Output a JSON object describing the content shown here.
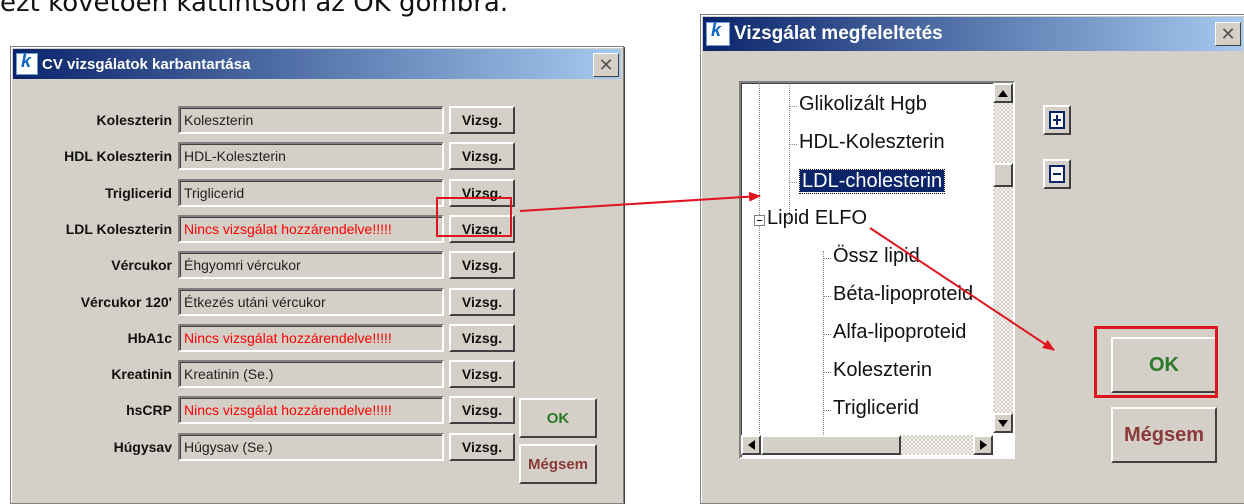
{
  "intro_text": "ezt követően kattintson az OK gombra.",
  "colors": {
    "title_start": "#0a246a",
    "highlight": "#e0141e",
    "missing_text": "#ff0000",
    "ok_text": "#2a7a2a",
    "cancel_text": "#8a3a3a"
  },
  "cv_window": {
    "title": "CV vizsgálatok karbantartása",
    "close_symbol": "✕",
    "rows": [
      {
        "label": "Koleszterin",
        "value": "Koleszterin",
        "missing": false,
        "button": "Vizsg."
      },
      {
        "label": "HDL Koleszterin",
        "value": "HDL-Koleszterin",
        "missing": false,
        "button": "Vizsg."
      },
      {
        "label": "Triglicerid",
        "value": "Triglicerid",
        "missing": false,
        "button": "Vizsg."
      },
      {
        "label": "LDL Koleszterin",
        "value": "Nincs vizsgálat hozzárendelve!!!!!",
        "missing": true,
        "button": "Vizsg."
      },
      {
        "label": "Vércukor",
        "value": "Éhgyomri vércukor",
        "missing": false,
        "button": "Vizsg."
      },
      {
        "label": "Vércukor 120'",
        "value": "Étkezés utáni vércukor",
        "missing": false,
        "button": "Vizsg."
      },
      {
        "label": "HbA1c",
        "value": "Nincs vizsgálat hozzárendelve!!!!!",
        "missing": true,
        "button": "Vizsg."
      },
      {
        "label": "Kreatinin",
        "value": "Kreatinin (Se.)",
        "missing": false,
        "button": "Vizsg."
      },
      {
        "label": "hsCRP",
        "value": "Nincs vizsgálat hozzárendelve!!!!!",
        "missing": true,
        "button": "Vizsg."
      },
      {
        "label": "Húgysav",
        "value": "Húgysav (Se.)",
        "missing": false,
        "button": "Vizsg."
      }
    ],
    "ok_label": "OK",
    "cancel_label": "Mégsem"
  },
  "match_window": {
    "title": "Vizsgálat megfeleltetés",
    "close_symbol": "✕",
    "tree_items": [
      {
        "label": "Glikolizált Hgb"
      },
      {
        "label": "HDL-Koleszterin"
      },
      {
        "label": "LDL-cholesterin",
        "selected": true
      },
      {
        "label": "Lipid ELFO",
        "expanded": true
      },
      {
        "label": "Össz lipid"
      },
      {
        "label": "Béta-lipoproteid"
      },
      {
        "label": "Alfa-lipoproteid"
      },
      {
        "label": "Koleszterin"
      },
      {
        "label": "Triglicerid"
      }
    ],
    "ok_label": "OK",
    "cancel_label": "Mégsem"
  }
}
